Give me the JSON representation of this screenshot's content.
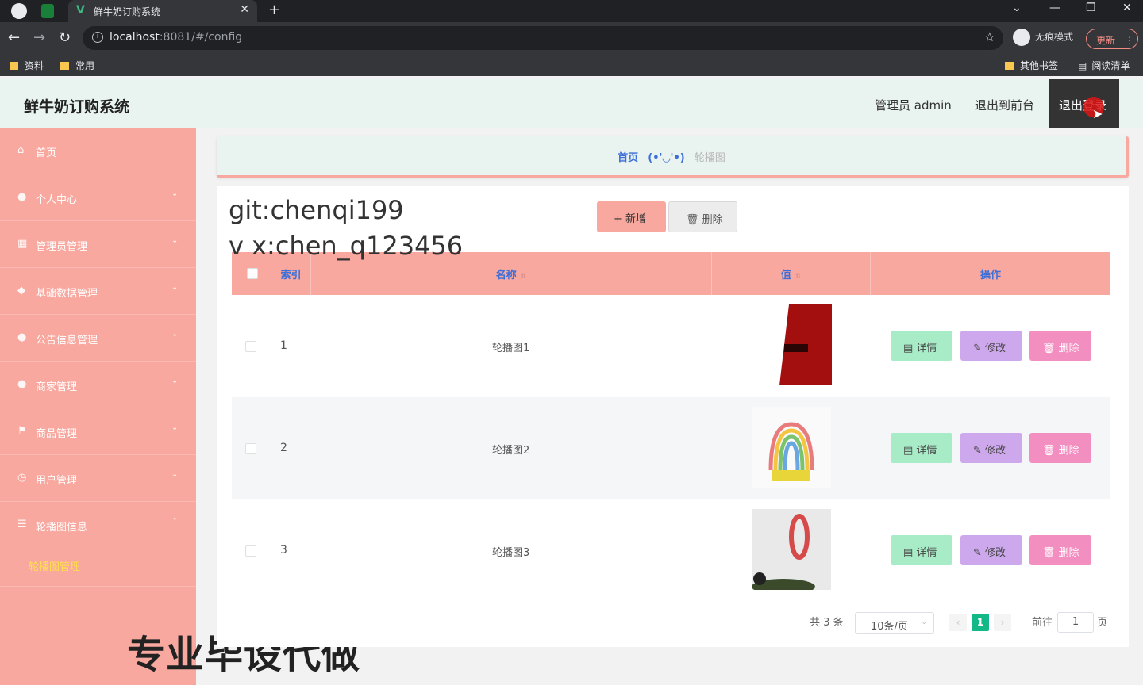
{
  "browser": {
    "tab_title": "鲜牛奶订购系统",
    "url_host": "localhost",
    "url_rest": ":8081/#/config",
    "incognito_label": "无痕模式",
    "update_label": "更新",
    "bookmarks": [
      "资料",
      "常用"
    ],
    "bookmarks_right": [
      "其他书签",
      "阅读清单"
    ]
  },
  "header": {
    "title": "鲜牛奶订购系统",
    "admin_label": "管理员 admin",
    "front_label": "退出到前台",
    "logout_label": "退出登录"
  },
  "sidebar": {
    "items": [
      {
        "label": "首页",
        "icon": "home-icon"
      },
      {
        "label": "个人中心",
        "icon": "user-icon"
      },
      {
        "label": "管理员管理",
        "icon": "grid-icon"
      },
      {
        "label": "基础数据管理",
        "icon": "tag-icon"
      },
      {
        "label": "公告信息管理",
        "icon": "chat-icon"
      },
      {
        "label": "商家管理",
        "icon": "user-icon"
      },
      {
        "label": "商品管理",
        "icon": "flag-icon"
      },
      {
        "label": "用户管理",
        "icon": "clock-icon"
      },
      {
        "label": "轮播图信息",
        "icon": "list-icon"
      }
    ],
    "submenu_label": "轮播图管理"
  },
  "watermark": "专业毕设代做",
  "breadcrumb": {
    "home": "首页",
    "face": "(•'◡'•)",
    "current": "轮播图"
  },
  "overlay": {
    "line1": "git:chenqi199",
    "line2": "v x:chen_q123456"
  },
  "toolbar": {
    "add_label": "新增",
    "delete_label": "删除"
  },
  "table": {
    "headers": {
      "index": "索引",
      "name": "名称",
      "value": "值",
      "ops": "操作"
    },
    "rows": [
      {
        "index": "1",
        "name": "轮播图1"
      },
      {
        "index": "2",
        "name": "轮播图2"
      },
      {
        "index": "3",
        "name": "轮播图3"
      }
    ],
    "actions": {
      "detail": "详情",
      "edit": "修改",
      "remove": "删除"
    }
  },
  "pagination": {
    "total": "共 3 条",
    "page_size": "10条/页",
    "current_page": "1",
    "goto_label": "前往",
    "goto_value": "1",
    "page_suffix": "页"
  },
  "colors": {
    "sidebar": "#f9a89f",
    "header_bg": "#e9f3ef",
    "accent_blue": "#3c6fd8",
    "detail_btn": "#a8ebc7",
    "edit_btn": "#cda8ec",
    "remove_btn": "#f38ec0",
    "active_page": "#12b886"
  }
}
